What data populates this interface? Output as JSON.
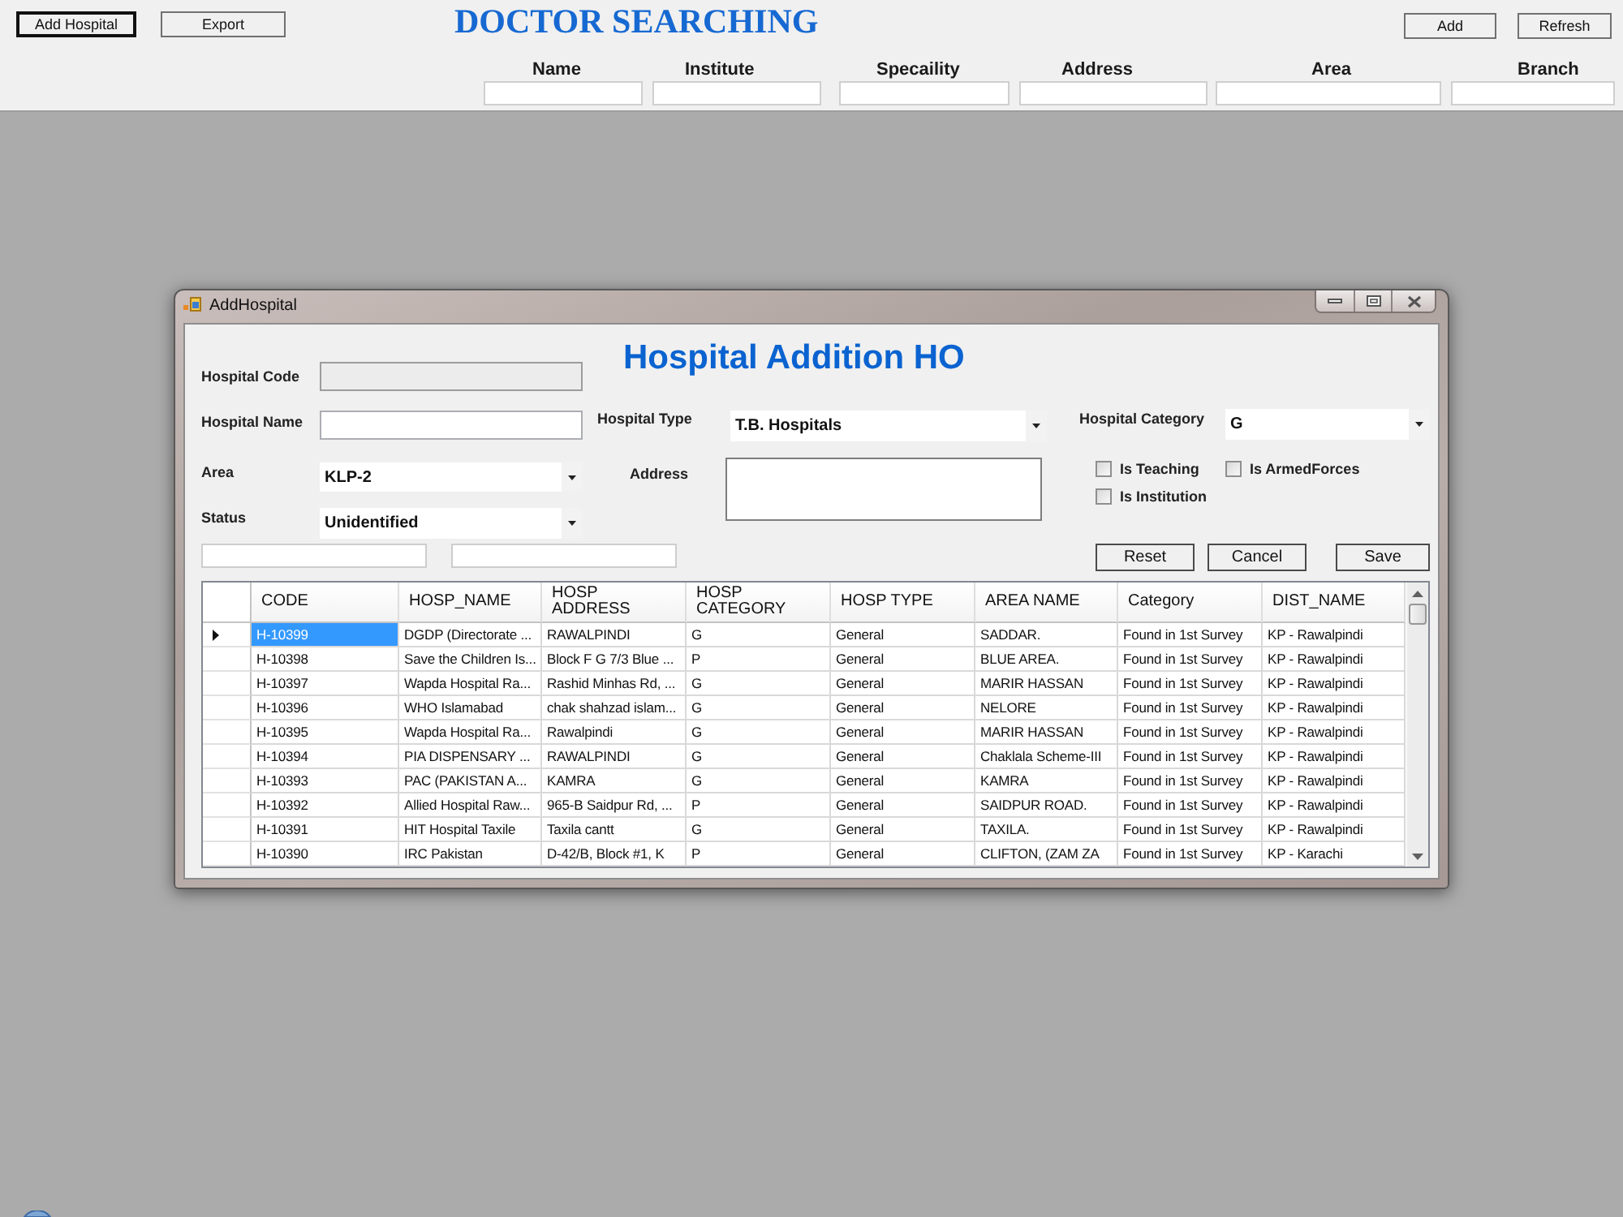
{
  "top_bar": {
    "buttons_left": [
      {
        "label": "Add Hospital",
        "focused": true
      },
      {
        "label": "Export",
        "focused": false
      }
    ],
    "title": "DOCTOR SEARCHING",
    "buttons_right": [
      {
        "label": "Add",
        "focused": false
      },
      {
        "label": "Refresh",
        "focused": false
      }
    ],
    "search_fields": [
      {
        "label": "Name"
      },
      {
        "label": "Institute"
      },
      {
        "label": "Specaility"
      },
      {
        "label": "Address"
      },
      {
        "label": "Area"
      },
      {
        "label": "Branch"
      }
    ]
  },
  "dialog": {
    "title": "AddHospital",
    "heading": "Hospital Addition HO",
    "hospital_code": {
      "label": "Hospital Code",
      "disabled": true
    },
    "hospital_name": {
      "label": "Hospital Name",
      "disabled": false
    },
    "hospital_type": {
      "label": "Hospital Type",
      "value": "T.B. Hospitals"
    },
    "hospital_category": {
      "label": "Hospital Category",
      "value": "G"
    },
    "area": {
      "label": "Area",
      "value": "KLP-2"
    },
    "address": {
      "label": "Address"
    },
    "status": {
      "label": "Status",
      "value": "Unidentified"
    },
    "checkboxes": [
      {
        "label": "Is Teaching",
        "checked": false
      },
      {
        "label": "Is ArmedForces",
        "checked": false
      },
      {
        "label": "Is Institution",
        "checked": false
      }
    ],
    "buttons": [
      "Reset",
      "Cancel",
      "Save"
    ],
    "table": {
      "columns": [
        "CODE",
        "HOSP_NAME",
        "HOSP ADDRESS",
        "HOSP CATEGORY",
        "HOSP TYPE",
        "AREA NAME",
        "Category",
        "DIST_NAME"
      ],
      "rows": [
        {
          "selected": true,
          "cells": [
            "H-10399",
            "DGDP (Directorate ...",
            "RAWALPINDI",
            "G",
            "General",
            "SADDAR.",
            "Found in 1st Survey",
            "KP - Rawalpindi"
          ]
        },
        {
          "selected": false,
          "cells": [
            "H-10398",
            "Save the Children Is...",
            "Block F G 7/3 Blue ...",
            "P",
            "General",
            "BLUE AREA.",
            "Found in 1st Survey",
            "KP - Rawalpindi"
          ]
        },
        {
          "selected": false,
          "cells": [
            "H-10397",
            "Wapda Hospital Ra...",
            "Rashid Minhas Rd, ...",
            "G",
            "General",
            "MARIR HASSAN",
            "Found in 1st Survey",
            "KP - Rawalpindi"
          ]
        },
        {
          "selected": false,
          "cells": [
            "H-10396",
            "WHO Islamabad",
            "chak shahzad islam...",
            "G",
            "General",
            "NELORE",
            "Found in 1st Survey",
            "KP - Rawalpindi"
          ]
        },
        {
          "selected": false,
          "cells": [
            "H-10395",
            "Wapda Hospital Ra...",
            "Rawalpindi",
            "G",
            "General",
            "MARIR HASSAN",
            "Found in 1st Survey",
            "KP - Rawalpindi"
          ]
        },
        {
          "selected": false,
          "cells": [
            "H-10394",
            "PIA DISPENSARY ...",
            "RAWALPINDI",
            "G",
            "General",
            "Chaklala Scheme-III",
            "Found in 1st Survey",
            "KP - Rawalpindi"
          ]
        },
        {
          "selected": false,
          "cells": [
            "H-10393",
            "PAC (PAKISTAN A...",
            "KAMRA",
            "G",
            "General",
            "KAMRA",
            "Found in 1st Survey",
            "KP - Rawalpindi"
          ]
        },
        {
          "selected": false,
          "cells": [
            "H-10392",
            "Allied Hospital Raw...",
            "965-B Saidpur Rd, ...",
            "P",
            "General",
            "SAIDPUR ROAD.",
            "Found in 1st Survey",
            "KP - Rawalpindi"
          ]
        },
        {
          "selected": false,
          "cells": [
            "H-10391",
            "HIT Hospital Taxile",
            "Taxila cantt",
            "G",
            "General",
            "TAXILA.",
            "Found in 1st Survey",
            "KP - Rawalpindi"
          ]
        },
        {
          "selected": false,
          "cells": [
            "H-10390",
            "IRC Pakistan",
            "D-42/B, Block #1, K",
            "P",
            "General",
            "CLIFTON, (ZAM ZA",
            "Found in 1st Survey",
            "KP - Karachi"
          ]
        }
      ]
    }
  }
}
